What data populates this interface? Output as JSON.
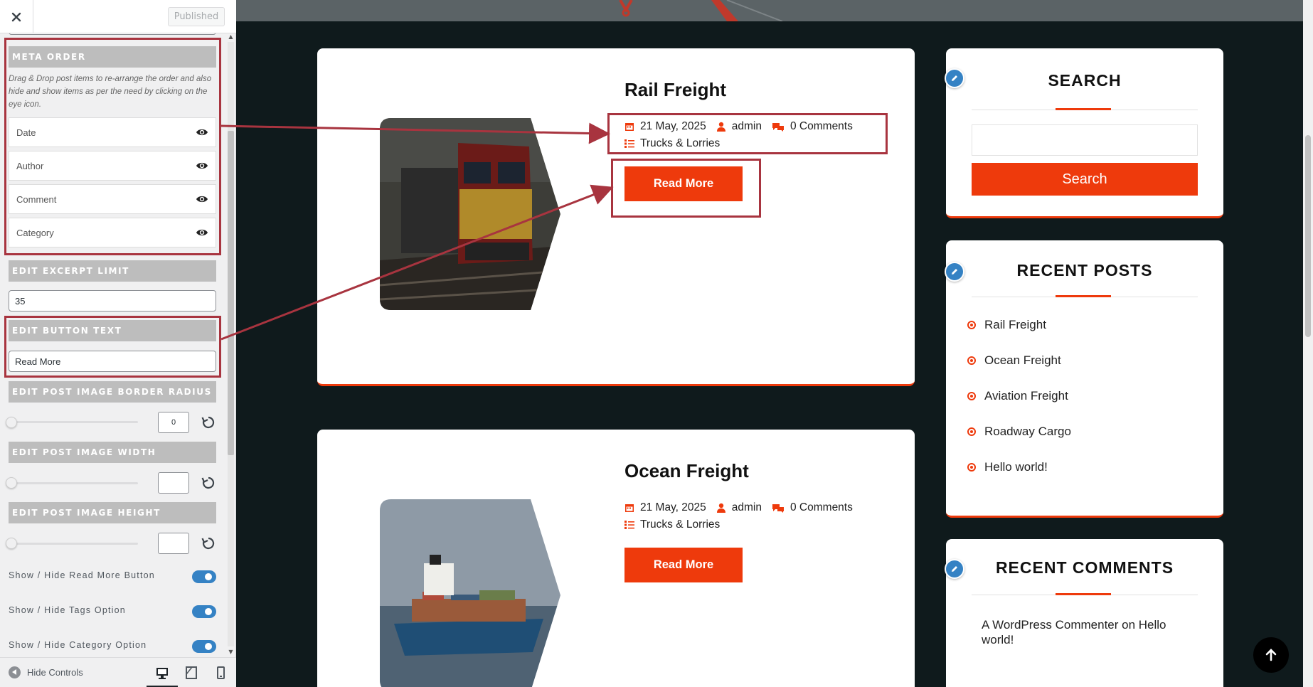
{
  "customizer": {
    "header": {
      "publish_label": "Published"
    },
    "meta_order": {
      "heading": "META ORDER",
      "description": "Drag & Drop post items to re-arrange the order and also hide and show items as per the need by clicking on the eye icon.",
      "items": [
        {
          "label": "Date"
        },
        {
          "label": "Author"
        },
        {
          "label": "Comment"
        },
        {
          "label": "Category"
        }
      ]
    },
    "excerpt_limit": {
      "heading": "EDIT EXCERPT LIMIT",
      "value": "35"
    },
    "button_text": {
      "heading": "EDIT BUTTON TEXT",
      "value": "Read More"
    },
    "border_radius": {
      "heading": "EDIT POST IMAGE BORDER RADIUS",
      "value": "0",
      "level": 0
    },
    "image_width": {
      "heading": "EDIT POST IMAGE WIDTH",
      "value": "",
      "level": 0
    },
    "image_height": {
      "heading": "EDIT POST IMAGE HEIGHT",
      "value": "",
      "level": 0
    },
    "toggles": [
      {
        "label": "Show / Hide Read More Button",
        "on": true
      },
      {
        "label": "Show / Hide Tags Option",
        "on": true
      },
      {
        "label": "Show / Hide Category Option",
        "on": true
      }
    ],
    "footer": {
      "hide_controls_label": "Hide Controls",
      "active_device": "desktop"
    }
  },
  "posts": [
    {
      "title": "Rail Freight",
      "date": "21 May, 2025",
      "author": "admin",
      "comments": "0 Comments",
      "category": "Trucks & Lorries",
      "button": "Read More"
    },
    {
      "title": "Ocean Freight",
      "date": "21 May, 2025",
      "author": "admin",
      "comments": "0 Comments",
      "category": "Trucks & Lorries",
      "button": "Read More"
    }
  ],
  "sidebar_widgets": {
    "search": {
      "title": "SEARCH",
      "button": "Search",
      "placeholder": ""
    },
    "recent_posts": {
      "title": "RECENT POSTS",
      "items": [
        "Rail Freight",
        "Ocean Freight",
        "Aviation Freight",
        "Roadway Cargo",
        "Hello world!"
      ]
    },
    "recent_comments": {
      "title": "RECENT COMMENTS",
      "text": "A WordPress Commenter on Hello world!"
    }
  },
  "colors": {
    "accent": "#ee3a0c",
    "annotation": "#a8343f",
    "wp_blue": "#3582c4"
  }
}
